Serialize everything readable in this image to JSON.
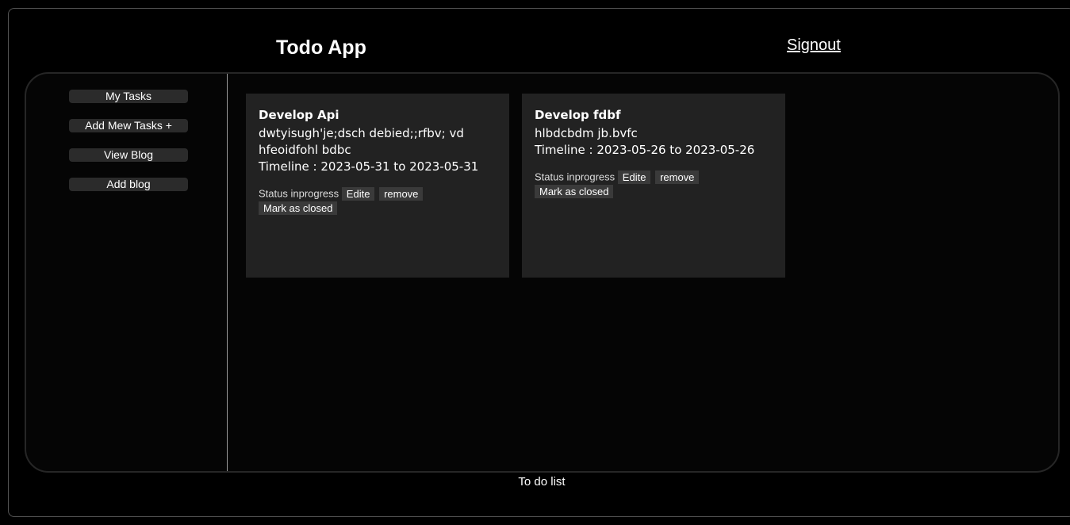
{
  "header": {
    "title": "Todo App",
    "signout_label": "Signout"
  },
  "sidebar": {
    "items": [
      {
        "label": "My Tasks"
      },
      {
        "label": "Add Mew Tasks +"
      },
      {
        "label": "View Blog"
      },
      {
        "label": "Add blog"
      }
    ]
  },
  "tasks": [
    {
      "title": "Develop Api",
      "description": "dwtyisugh'je;dsch debied;;rfbv; vd hfeoidfohl bdbc",
      "timeline": "Timeline : 2023-05-31 to 2023-05-31",
      "status": "Status inprogress",
      "edit_label": "Edite",
      "remove_label": "remove",
      "close_label": "Mark as closed"
    },
    {
      "title": "Develop fdbf",
      "description": "hlbdcbdm jb.bvfc",
      "timeline": "Timeline : 2023-05-26 to 2023-05-26",
      "status": "Status inprogress",
      "edit_label": "Edite",
      "remove_label": "remove",
      "close_label": "Mark as closed"
    }
  ],
  "footer": {
    "text": "To do list"
  }
}
